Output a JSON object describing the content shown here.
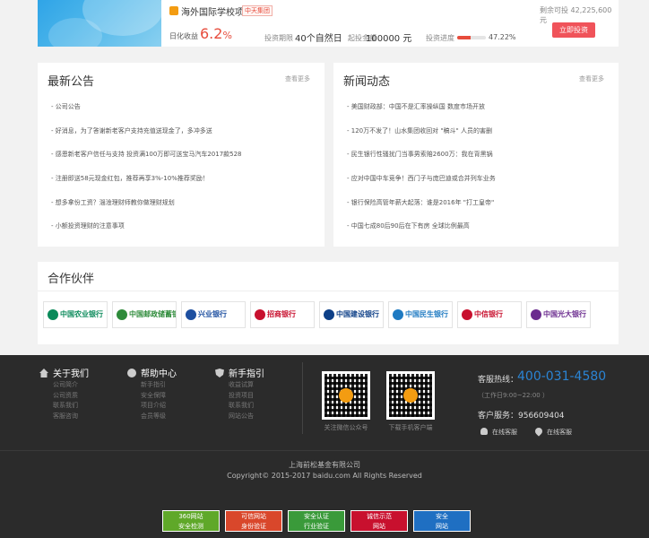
{
  "product": {
    "title": "海外国际学校项目",
    "badge": "中天集团",
    "rate_label": "日化收益",
    "rate_value": "6.2",
    "rate_unit": "%",
    "term_label": "投资期限",
    "term_value": "40个自然日",
    "amount_label": "起投金额",
    "amount_value": "100000 元",
    "progress_label": "投资进度",
    "progress_value": "47.22%",
    "progress_fraction": 0.4722,
    "remaining_text": "剩余可投 42,225,600元",
    "invest_button": "立即投资"
  },
  "notices": {
    "title": "最新公告",
    "more": "查看更多",
    "items": [
      "- 公司公告",
      "- 好消息，为了答谢新老客户支持充值送现金了，多冲多送",
      "- 感恩新老客户信任与支持 投资满100万即可送宝马汽车2017款528",
      "- 注册即送58元现金红包，推荐再享3%-10%推荐奖励！",
      "- 想多拿份工资？淄淦理财师教你做理财规划",
      "- 小额投资理财的注意事项"
    ]
  },
  "news": {
    "title": "新闻动态",
    "more": "查看更多",
    "items": [
      "- 美国财政部：中国不是汇率操纵国 数度市场开放",
      "- 120万不发了！山水集团收回对 \"稿斗\" 人员的害删",
      "- 民生银行性骚扰门当事男索赔2600万：我在背黑锅",
      "- 应对中国中车竞争！西门子与庞巴迪或合并列车业务",
      "- 银行保险高管年薪大起落：谁是2016年 \"打工皇帝\"",
      "- 中国七成80后90后在下有房  全球比例最高"
    ]
  },
  "partners": {
    "title": "合作伙伴",
    "logos": [
      {
        "name": "中国农业银行",
        "color": "#0a8a5a"
      },
      {
        "name": "中国邮政储蓄银行",
        "color": "#2e8b3a"
      },
      {
        "name": "兴业银行",
        "color": "#1d4fa0"
      },
      {
        "name": "招商银行",
        "color": "#c8102e"
      },
      {
        "name": "中国建设银行",
        "color": "#0d3f87"
      },
      {
        "name": "中国民生银行",
        "color": "#1e7ac2"
      },
      {
        "name": "中信银行",
        "color": "#c8102e"
      },
      {
        "name": "中国光大银行",
        "color": "#6b2c8f"
      }
    ]
  },
  "footer": {
    "about": {
      "title": "关于我们",
      "items": [
        "公司简介",
        "公司资质",
        "联系我们",
        "客服咨询"
      ]
    },
    "help": {
      "title": "帮助中心",
      "items": [
        "新手指引",
        "安全保障",
        "项目介绍",
        "会员等级"
      ]
    },
    "guide": {
      "title": "新手指引",
      "items": [
        "收益试算",
        "投资项目",
        "联系我们",
        "网站公告"
      ]
    },
    "qr_wechat_label": "关注微信公众号",
    "qr_app_label": "下载手机客户端",
    "hotline_label": "客服热线：",
    "hotline": "400-031-4580",
    "hours": "（工作日9:00~22:00 ）",
    "service": "客户服务：956609404",
    "online_service_1": "在线客服",
    "online_service_2": "在线客服",
    "company": "上海前松基金有限公司",
    "copyright": "Copyright© 2015-2017 baidu.com All Rights Reserved",
    "badges": [
      {
        "line1": "360网站",
        "line2": "安全检测",
        "color": "#5fa829"
      },
      {
        "line1": "可信网站",
        "line2": "身份验证",
        "color": "#d9472b"
      },
      {
        "line1": "安全认证",
        "line2": "行业验证",
        "color": "#3a9a3a"
      },
      {
        "line1": "诚信示范",
        "line2": "网站",
        "color": "#c8102e"
      },
      {
        "line1": "安全",
        "line2": "网站",
        "color": "#1f6fc2"
      }
    ]
  }
}
